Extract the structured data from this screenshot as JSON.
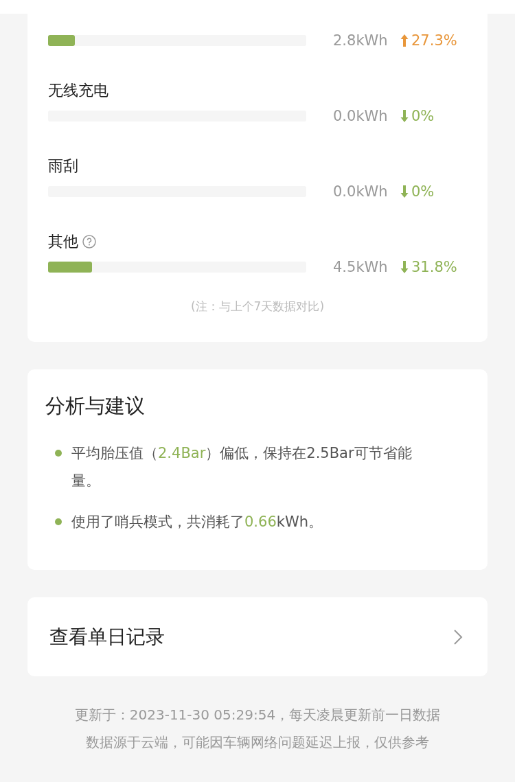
{
  "usage": {
    "items": [
      {
        "value": "2.8kWh",
        "kind": "up",
        "change": "27.3%",
        "level": 0.104
      },
      {
        "label": "无线充电",
        "value": "0.0kWh",
        "kind": "down",
        "change": "0%",
        "level": 0
      },
      {
        "label": "雨刮",
        "value": "0.0kWh",
        "kind": "down",
        "change": "0%",
        "level": 0
      },
      {
        "label": "其他",
        "help": true,
        "value": "4.5kWh",
        "kind": "down",
        "change": "31.8%",
        "level": 0.17
      }
    ],
    "note": "(注：与上个7天数据对比)"
  },
  "advice": {
    "title": "分析与建议",
    "items": [
      [
        {
          "text": "平均胎压值（",
          "highlight": false
        },
        {
          "text": "2.4Bar",
          "highlight": true
        },
        {
          "text": "）偏低，保持在2.5Bar可节省能量。",
          "highlight": false
        }
      ],
      [
        {
          "text": "使用了哨兵模式，共消耗了",
          "highlight": false
        },
        {
          "text": "0.66",
          "highlight": true
        },
        {
          "text": "kWh。",
          "highlight": false
        }
      ]
    ]
  },
  "daily_link": {
    "label": "查看单日记录"
  },
  "footer": [
    "更新于：2023-11-30 05:29:54，每天凌晨更新前一日数据",
    "数据源于云端，可能因车辆网络问题延迟上报，仅供参考"
  ]
}
